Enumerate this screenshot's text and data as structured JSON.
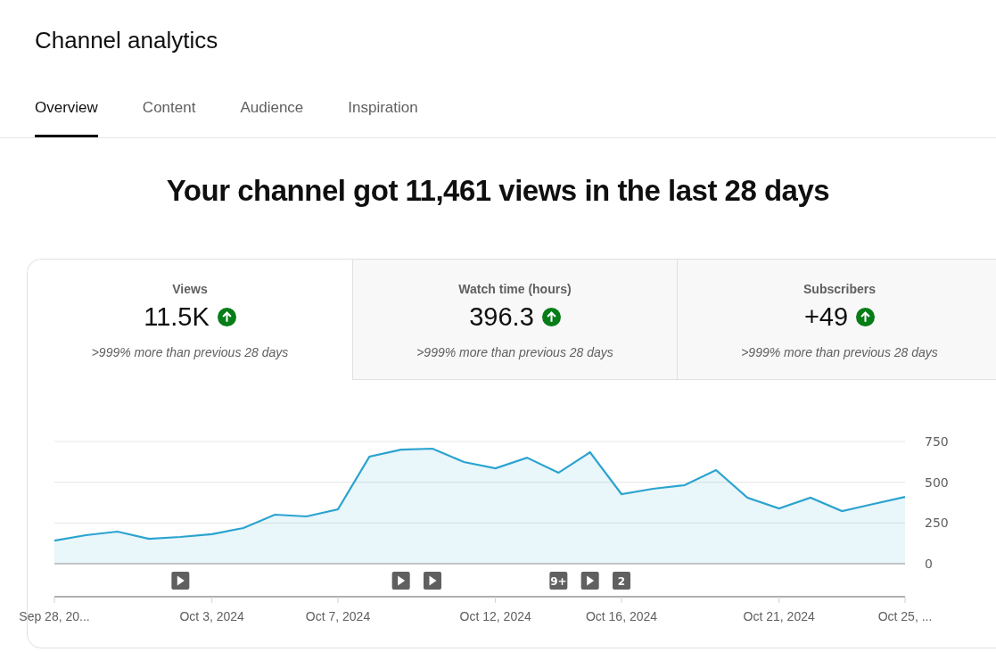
{
  "page": {
    "title": "Channel analytics"
  },
  "tabs": [
    {
      "label": "Overview",
      "selected": true
    },
    {
      "label": "Content",
      "selected": false
    },
    {
      "label": "Audience",
      "selected": false
    },
    {
      "label": "Inspiration",
      "selected": false
    }
  ],
  "headline": "Your channel got 11,461 views in the last 28 days",
  "metrics": [
    {
      "label": "Views",
      "value": "11.5K",
      "comparison": ">999% more than previous 28 days",
      "selected": true
    },
    {
      "label": "Watch time (hours)",
      "value": "396.3",
      "comparison": ">999% more than previous 28 days",
      "selected": false
    },
    {
      "label": "Subscribers",
      "value": "+49",
      "comparison": ">999% more than previous 28 days",
      "selected": false
    }
  ],
  "chart": {
    "chart_data": {
      "type": "area",
      "categories": [
        "Sep 28, 20...",
        null,
        null,
        null,
        null,
        "Oct 3, 2024",
        null,
        null,
        null,
        "Oct 7, 2024",
        null,
        null,
        null,
        null,
        "Oct 12, 2024",
        null,
        null,
        null,
        "Oct 16, 2024",
        null,
        null,
        null,
        null,
        "Oct 21, 2024",
        null,
        null,
        null,
        "Oct 25, ..."
      ],
      "series": [
        {
          "color": "#2aa3cf",
          "values": [
            142,
            175,
            197,
            153,
            164,
            181,
            219,
            301,
            290,
            334,
            657,
            700,
            706,
            624,
            586,
            651,
            558,
            684,
            427,
            460,
            482,
            575,
            405,
            339,
            405,
            323,
            367,
            410
          ]
        }
      ],
      "ylim": [
        0,
        750
      ],
      "yticks": [
        0,
        250,
        500,
        750
      ]
    },
    "markers": [
      {
        "kind": "none"
      },
      {
        "kind": "none"
      },
      {
        "kind": "none"
      },
      {
        "kind": "none"
      },
      {
        "kind": "video"
      },
      {
        "kind": "none"
      },
      {
        "kind": "none"
      },
      {
        "kind": "none"
      },
      {
        "kind": "none"
      },
      {
        "kind": "none"
      },
      {
        "kind": "none"
      },
      {
        "kind": "video"
      },
      {
        "kind": "video"
      },
      {
        "kind": "none"
      },
      {
        "kind": "none"
      },
      {
        "kind": "none"
      },
      {
        "kind": "count",
        "label": "9+"
      },
      {
        "kind": "video"
      },
      {
        "kind": "count",
        "label": "2"
      },
      {
        "kind": "none"
      },
      {
        "kind": "none"
      },
      {
        "kind": "none"
      },
      {
        "kind": "none"
      },
      {
        "kind": "none"
      },
      {
        "kind": "none"
      },
      {
        "kind": "none"
      },
      {
        "kind": "none"
      },
      {
        "kind": "none"
      }
    ]
  }
}
